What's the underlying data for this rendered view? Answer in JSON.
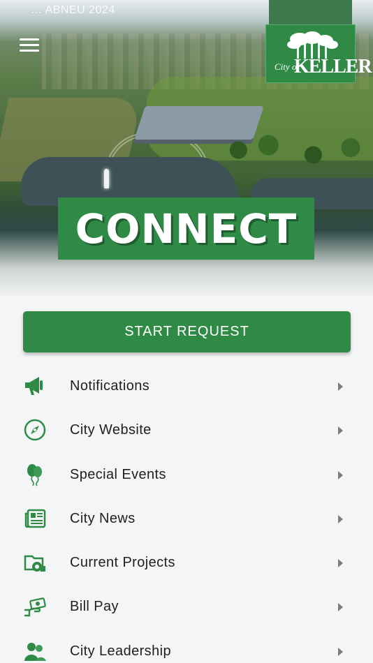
{
  "status_bar": {
    "time": "… ABNEU 2024"
  },
  "header": {
    "menu_icon": "hamburger-menu-icon",
    "logo": {
      "prefix": "City of",
      "name": "KELLER"
    },
    "banner_text": "CONNECT"
  },
  "main": {
    "start_request_label": "START REQUEST",
    "items": [
      {
        "label": "Notifications",
        "icon": "megaphone-icon"
      },
      {
        "label": "City Website",
        "icon": "compass-icon"
      },
      {
        "label": "Special Events",
        "icon": "balloons-icon"
      },
      {
        "label": "City News",
        "icon": "newspaper-icon"
      },
      {
        "label": "Current Projects",
        "icon": "project-folder-icon"
      },
      {
        "label": "Bill Pay",
        "icon": "hand-money-icon"
      },
      {
        "label": "City Leadership",
        "icon": "people-icon"
      }
    ]
  },
  "colors": {
    "brand_green": "#2f8a46",
    "chevron": "#7b7b7b",
    "background": "#f4f5f6"
  }
}
